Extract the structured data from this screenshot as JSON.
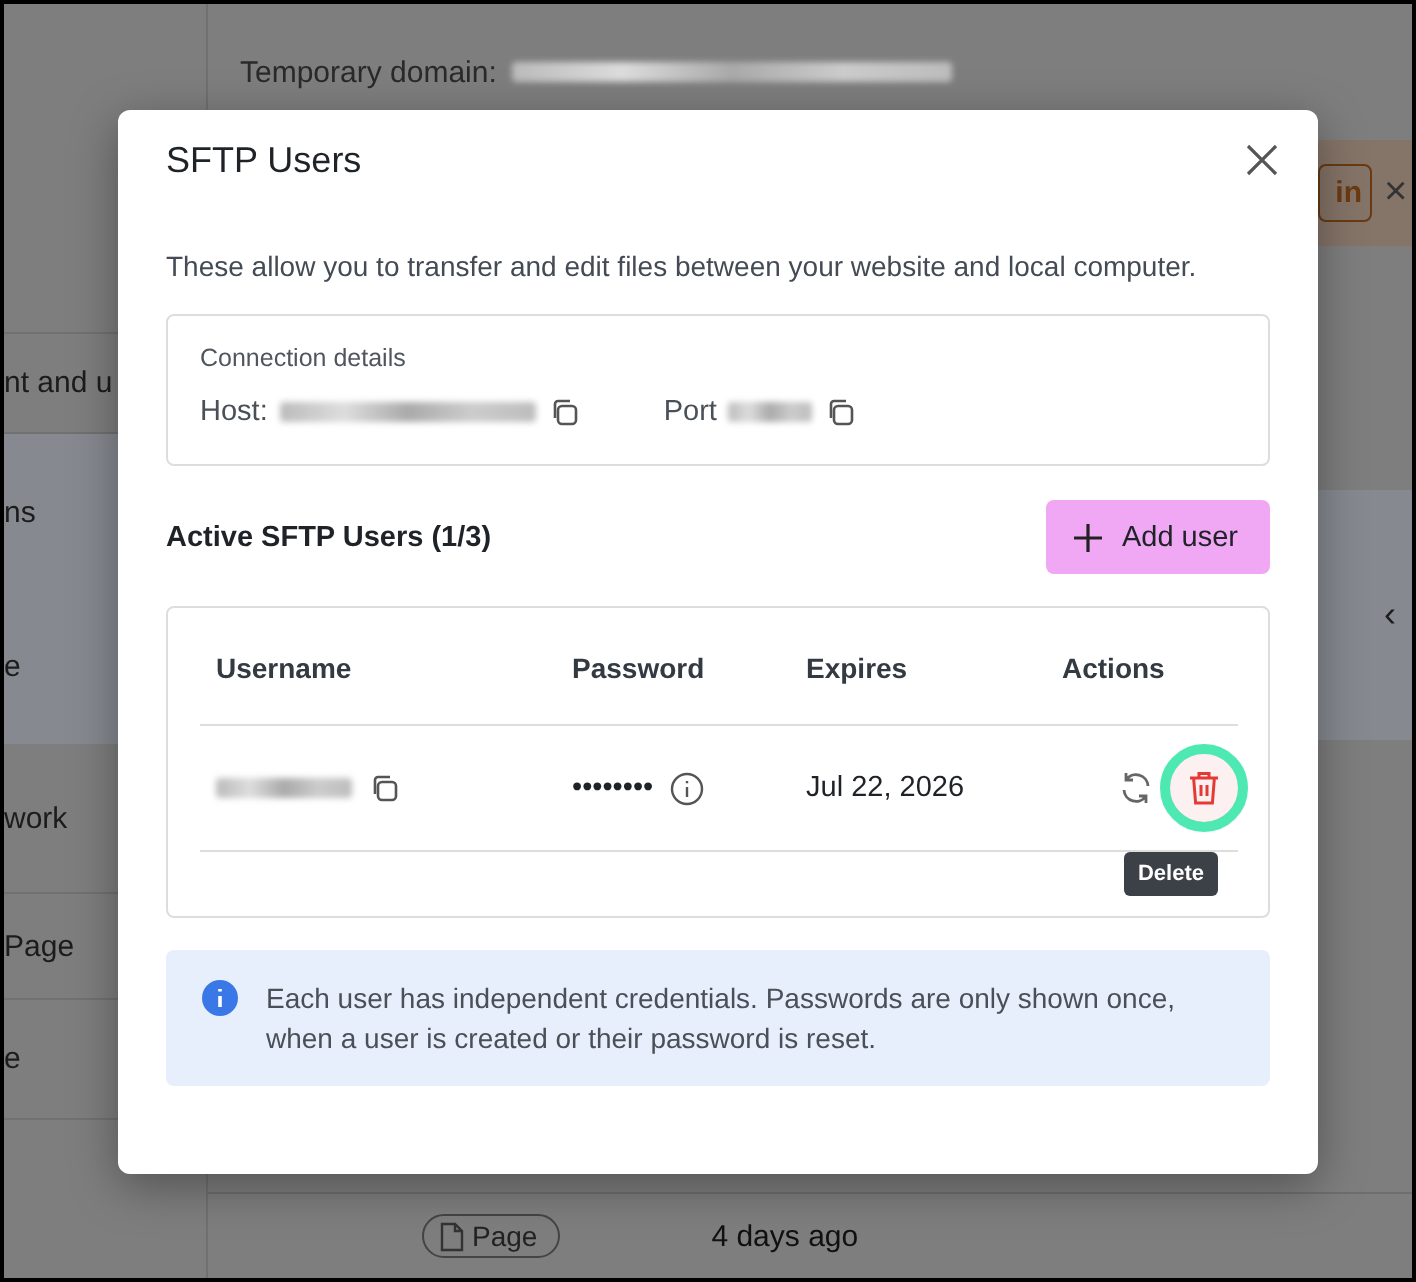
{
  "background": {
    "domain_label": "Temporary domain:",
    "side_items": [
      {
        "label": "nt and u",
        "selected": false
      },
      {
        "label": "ns",
        "selected": true
      },
      {
        "label": "e",
        "selected": true
      },
      {
        "label": "work",
        "selected": false
      },
      {
        "label": "Page",
        "selected": false
      },
      {
        "label": "e",
        "selected": false
      }
    ],
    "banner_button": "in",
    "banner_close": "×",
    "collapse": "‹",
    "row": {
      "type_chip": "Page",
      "modified": "4 days ago"
    }
  },
  "dialog": {
    "title": "SFTP Users",
    "description": "These allow you to transfer and edit files between your website and local computer.",
    "connection": {
      "title": "Connection details",
      "host_label": "Host:",
      "port_label": "Port"
    },
    "users_heading": "Active SFTP Users (1/3)",
    "add_button": "Add user",
    "columns": [
      "Username",
      "Password",
      "Expires",
      "Actions"
    ],
    "rows": [
      {
        "password": "••••••••",
        "expires": "Jul 22, 2026",
        "delete_highlighted": true,
        "tooltip": "Delete"
      }
    ],
    "info": "Each user has independent credentials. Passwords are only shown once, when a user is created or their password is reset."
  }
}
